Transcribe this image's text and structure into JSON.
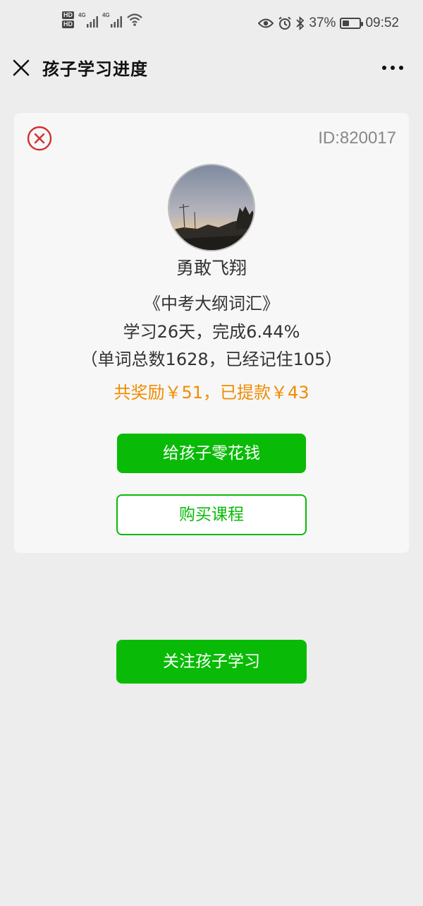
{
  "status_bar": {
    "hd_top": "HD",
    "hd_bottom": "HD",
    "sim1_net": "4G",
    "sim2_net": "4G",
    "battery_percent": "37%",
    "battery_level": 0.37,
    "time": "09:52",
    "icons": [
      "eye-icon",
      "alarm-icon",
      "bluetooth-icon",
      "wifi-icon"
    ]
  },
  "navbar": {
    "title": "孩子学习进度",
    "close_icon": "close-icon",
    "more_icon": "more-icon"
  },
  "card": {
    "id_text": "ID:820017",
    "nickname": "勇敢飞翔",
    "book": "《中考大纲词汇》",
    "progress": "学习26天，完成6.44%",
    "words": "（单词总数1628，已经记住105）",
    "reward": "共奖励￥51，已提款￥43",
    "pocket_money_button": "给孩子零花钱",
    "buy_course_button": "购买课程"
  },
  "follow_button": "关注孩子学习",
  "colors": {
    "green": "#09bb07",
    "orange": "#f08c00",
    "red": "#d32f2f"
  }
}
